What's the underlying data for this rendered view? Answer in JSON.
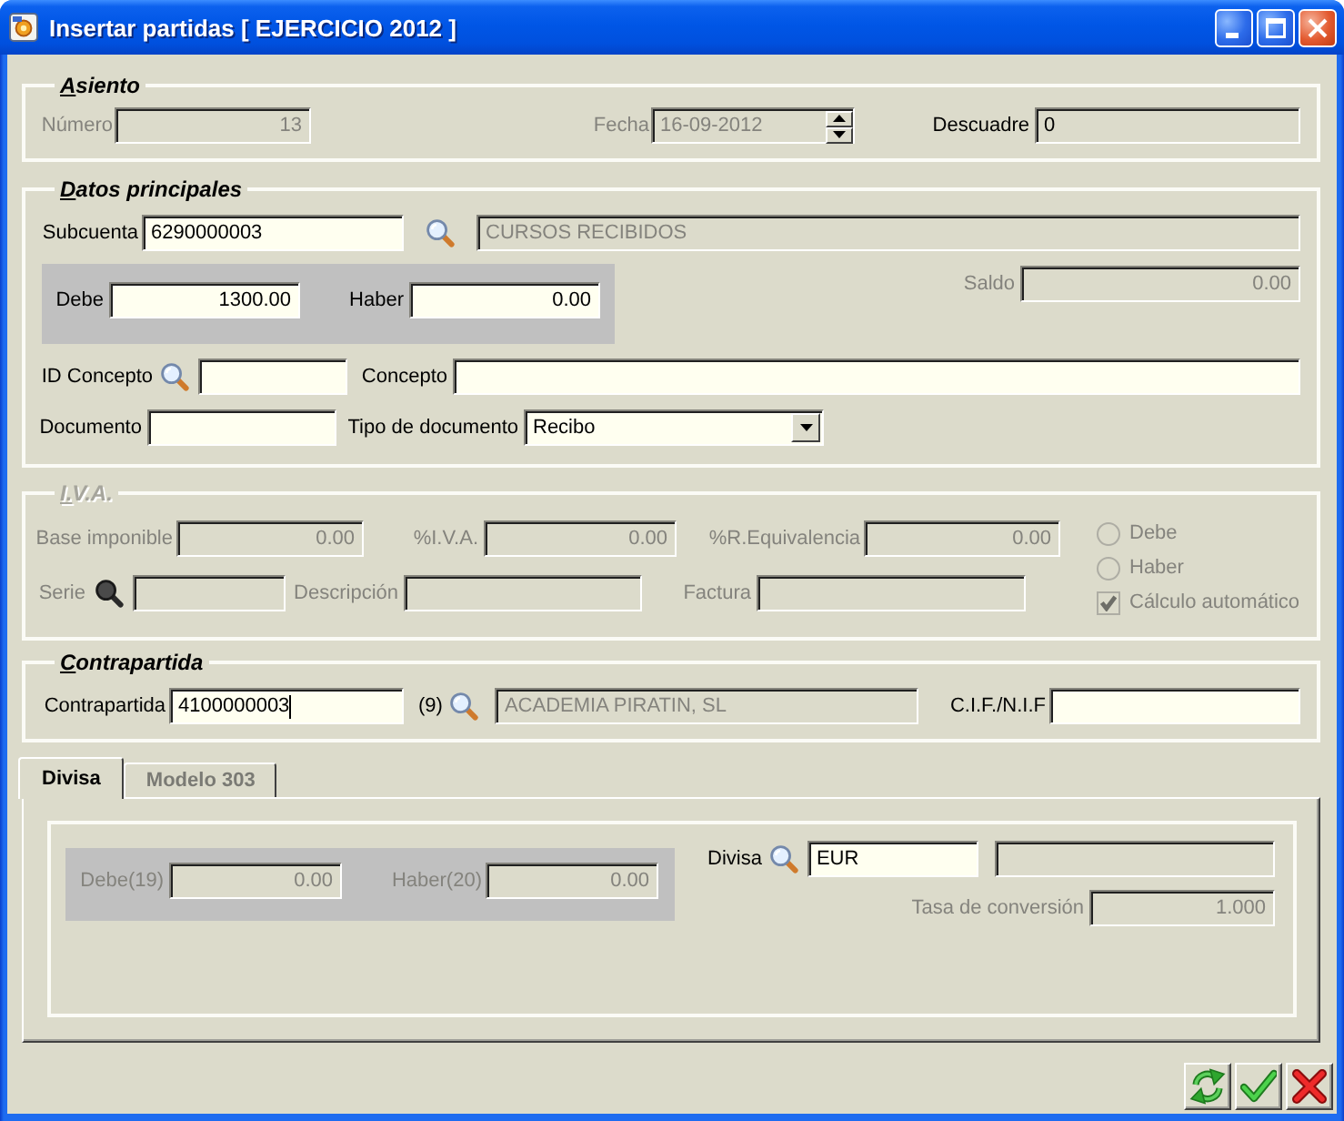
{
  "window": {
    "title": "Insertar partidas [ EJERCICIO 2012 ]"
  },
  "asiento": {
    "legend": "Asiento",
    "numero": {
      "label": "Número",
      "value": "13",
      "disabled": true,
      "readonly": true
    },
    "fecha": {
      "label": "Fecha",
      "value": "16-09-2012",
      "disabled": true,
      "readonly": true
    },
    "descuadre": {
      "label": "Descuadre",
      "value": "0",
      "disabled": false,
      "readonly": true
    }
  },
  "datos_principales": {
    "legend": "Datos principales",
    "subcuenta": {
      "label": "Subcuenta",
      "value": "6290000003",
      "disabled": false,
      "readonly": false
    },
    "subcuenta_nombre": {
      "value": "CURSOS RECIBIDOS",
      "disabled": true,
      "readonly": true
    },
    "debe": {
      "label": "Debe",
      "value": "1300.00",
      "disabled": false,
      "readonly": false
    },
    "haber": {
      "label": "Haber",
      "value": "0.00",
      "disabled": false,
      "readonly": false
    },
    "saldo": {
      "label": "Saldo",
      "value": "0.00",
      "disabled": true,
      "readonly": true
    },
    "id_concepto": {
      "label": "ID Concepto",
      "disabled": false,
      "readonly": false
    },
    "concepto": {
      "label": "Concepto",
      "disabled": false,
      "readonly": false
    },
    "documento": {
      "label": "Documento",
      "disabled": false,
      "readonly": false
    },
    "tipo_documento": {
      "label": "Tipo de documento",
      "value": "Recibo",
      "disabled": false,
      "readonly": false
    }
  },
  "iva": {
    "legend": "I.V.A.",
    "disabled": true,
    "base_imponible": {
      "label": "Base imponible",
      "value": "0.00",
      "disabled": true,
      "readonly": true
    },
    "pct_iva": {
      "label": "%I.V.A.",
      "value": "0.00",
      "disabled": true,
      "readonly": true
    },
    "pct_recargo": {
      "label": "%R.Equivalencia",
      "value": "0.00",
      "disabled": true,
      "readonly": true
    },
    "serie": {
      "label": "Serie",
      "disabled": true,
      "readonly": true
    },
    "descripcion": {
      "label": "Descripción",
      "disabled": true,
      "readonly": true
    },
    "factura": {
      "label": "Factura",
      "disabled": true,
      "readonly": true
    },
    "options": [
      {
        "kind": "radio",
        "label": "Debe",
        "checked": false
      },
      {
        "kind": "radio",
        "label": "Haber",
        "checked": false
      },
      {
        "kind": "checkbox",
        "label": "Cálculo automático",
        "checked": true
      }
    ]
  },
  "contrapartida": {
    "legend": "Contrapartida",
    "cuenta": {
      "label": "Contrapartida",
      "value": "4100000003",
      "disabled": false,
      "readonly": false,
      "focused": true
    },
    "count": "(9)",
    "nombre": {
      "value": "ACADEMIA PIRATIN, SL",
      "disabled": true,
      "readonly": true
    },
    "cif": {
      "label": "C.I.F./N.I.F",
      "disabled": false,
      "readonly": false
    }
  },
  "tabs": [
    {
      "label": "Divisa",
      "selected": true
    },
    {
      "label": "Modelo 303",
      "selected": false
    }
  ],
  "divisa_tab": {
    "debe": {
      "label": "Debe(19)",
      "value": "0.00",
      "disabled": true,
      "readonly": true
    },
    "haber": {
      "label": "Haber(20)",
      "value": "0.00",
      "disabled": true,
      "readonly": true
    },
    "divisa": {
      "label": "Divisa",
      "value": "EUR",
      "disabled": false,
      "readonly": false
    },
    "divisa_nombre": {
      "readonly": true
    },
    "tasa": {
      "label": "Tasa de conversión",
      "value": "1.000",
      "disabled": true,
      "readonly": true
    }
  },
  "buttons": [
    {
      "kind": "refresh"
    },
    {
      "kind": "accept"
    },
    {
      "kind": "cancel"
    }
  ]
}
